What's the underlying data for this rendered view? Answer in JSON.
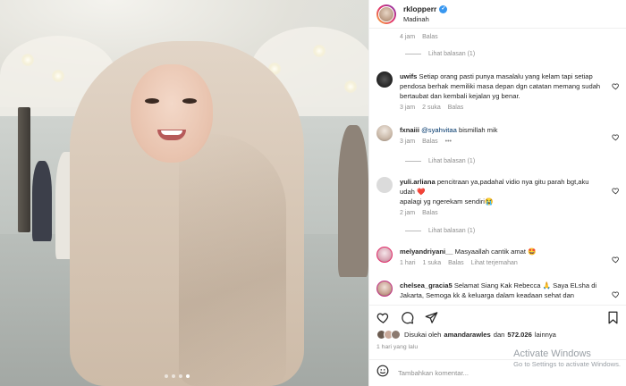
{
  "post": {
    "username": "rklopperr",
    "location": "Madinah",
    "verified_icon": "verified-badge-icon"
  },
  "top_meta": {
    "time": "4 jam",
    "reply": "Balas"
  },
  "replies_1": "Lihat balasan (1)",
  "comments": [
    {
      "user": "uwifs",
      "text": "Setiap orang pasti punya masalalu yang kelam tapi setiap pendosa berhak memiliki masa depan dgn catatan memang sudah bertaubat dan kembali kejalan yg benar.",
      "time": "3 jam",
      "likes": "2 suka",
      "reply": "Balas"
    },
    {
      "user": "fxnaiii",
      "mention": "@syahvitaa",
      "text": "bismillah mik",
      "time": "3 jam",
      "reply": "Balas",
      "more": "•••"
    },
    {
      "user": "yuli.arliana",
      "text": "pencitraan ya,padahal vidio nya gitu parah bgt,aku udah ❤️",
      "text2": "apalagi yg ngerekam sendiri😭",
      "time": "2 jam",
      "reply": "Balas"
    },
    {
      "user": "melyandriyani__",
      "text": "Masyaallah cantik amat 🤩",
      "time": "1 hari",
      "likes": "1 suka",
      "reply": "Balas",
      "translate": "Lihat terjemahan"
    },
    {
      "user": "chelsea_gracia5",
      "text": "Selamat Siang Kak Rebecca 🙏 Saya ELsha di Jakarta, Semoga kk & keluarga dalam keadaan sehat dan"
    }
  ],
  "replies_2": "Lihat balasan (1)",
  "replies_3": "Lihat balasan (1)",
  "likes": {
    "prefix": "Disukai oleh",
    "user": "amandarawles",
    "connector": "dan",
    "count": "572.026",
    "suffix": "lainnya"
  },
  "posted": "1 hari yang lalu",
  "add_comment": {
    "placeholder": "Tambahkan komentar..."
  },
  "watermark": {
    "line1": "Activate Windows",
    "line2": "Go to Settings to activate Windows."
  },
  "colors": {
    "verified": "#3897f0",
    "text": "#262626",
    "muted": "#8e8e8e",
    "mention": "#00376b"
  }
}
